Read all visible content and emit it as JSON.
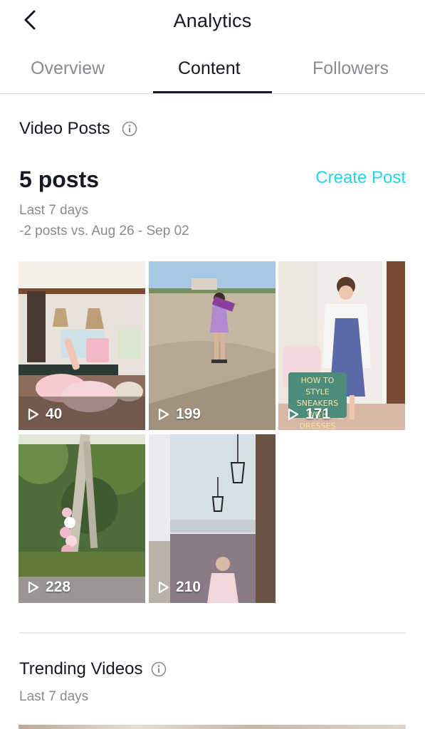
{
  "header": {
    "title": "Analytics",
    "back_icon": "chevron-left-icon"
  },
  "tabs": [
    {
      "label": "Overview",
      "active": false
    },
    {
      "label": "Content",
      "active": true
    },
    {
      "label": "Followers",
      "active": false
    }
  ],
  "video_posts": {
    "title": "Video Posts",
    "info_icon": "info-icon",
    "count_label": "5 posts",
    "create_label": "Create Post",
    "period": "Last 7 days",
    "comparison": "-2 posts vs. Aug 26 - Sep 02",
    "posts": [
      {
        "views": "40",
        "caption": ""
      },
      {
        "views": "199",
        "caption": ""
      },
      {
        "views": "171",
        "caption": "HOW TO STYLE SNEAKERS WITH DRESSES"
      },
      {
        "views": "228",
        "caption": ""
      },
      {
        "views": "210",
        "caption": ""
      }
    ]
  },
  "trending": {
    "title": "Trending Videos",
    "info_icon": "info-icon",
    "period": "Last 7 days"
  },
  "colors": {
    "accent": "#20d5ec",
    "text_primary": "#161823",
    "text_secondary": "#8a8b91"
  }
}
